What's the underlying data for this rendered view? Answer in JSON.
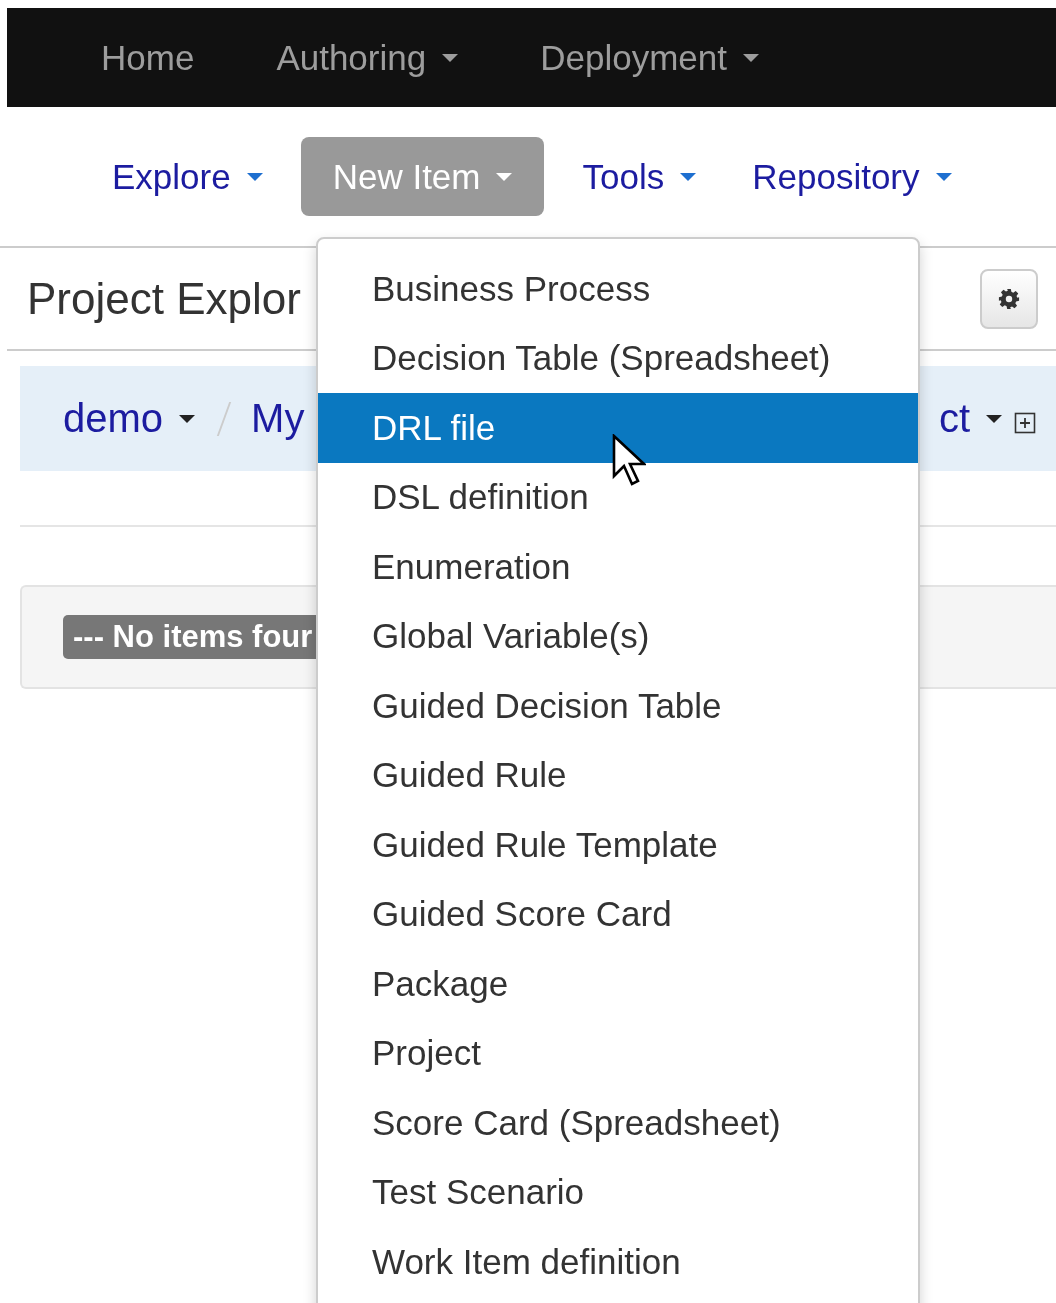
{
  "navbar": {
    "items": [
      {
        "label": "Home",
        "caret": false
      },
      {
        "label": "Authoring",
        "caret": true
      },
      {
        "label": "Deployment",
        "caret": true
      }
    ]
  },
  "subnav": {
    "items": [
      {
        "label": "Explore",
        "selected": false
      },
      {
        "label": "New Item",
        "selected": true
      },
      {
        "label": "Tools",
        "selected": false
      },
      {
        "label": "Repository",
        "selected": false
      }
    ]
  },
  "header": {
    "title": "Project Explor"
  },
  "breadcrumb": {
    "items": [
      "demo",
      "My"
    ],
    "end": "ct"
  },
  "panel": {
    "label": "--- No items four"
  },
  "dropdown": {
    "items": [
      {
        "label": "Business Process",
        "selected": false
      },
      {
        "label": "Decision Table (Spreadsheet)",
        "selected": false
      },
      {
        "label": "DRL file",
        "selected": true
      },
      {
        "label": "DSL definition",
        "selected": false
      },
      {
        "label": "Enumeration",
        "selected": false
      },
      {
        "label": "Global Variable(s)",
        "selected": false
      },
      {
        "label": "Guided Decision Table",
        "selected": false
      },
      {
        "label": "Guided Rule",
        "selected": false
      },
      {
        "label": "Guided Rule Template",
        "selected": false
      },
      {
        "label": "Guided Score Card",
        "selected": false
      },
      {
        "label": "Package",
        "selected": false
      },
      {
        "label": "Project",
        "selected": false
      },
      {
        "label": "Score Card (Spreadsheet)",
        "selected": false
      },
      {
        "label": "Test Scenario",
        "selected": false
      },
      {
        "label": "Work Item definition",
        "selected": false
      }
    ]
  }
}
